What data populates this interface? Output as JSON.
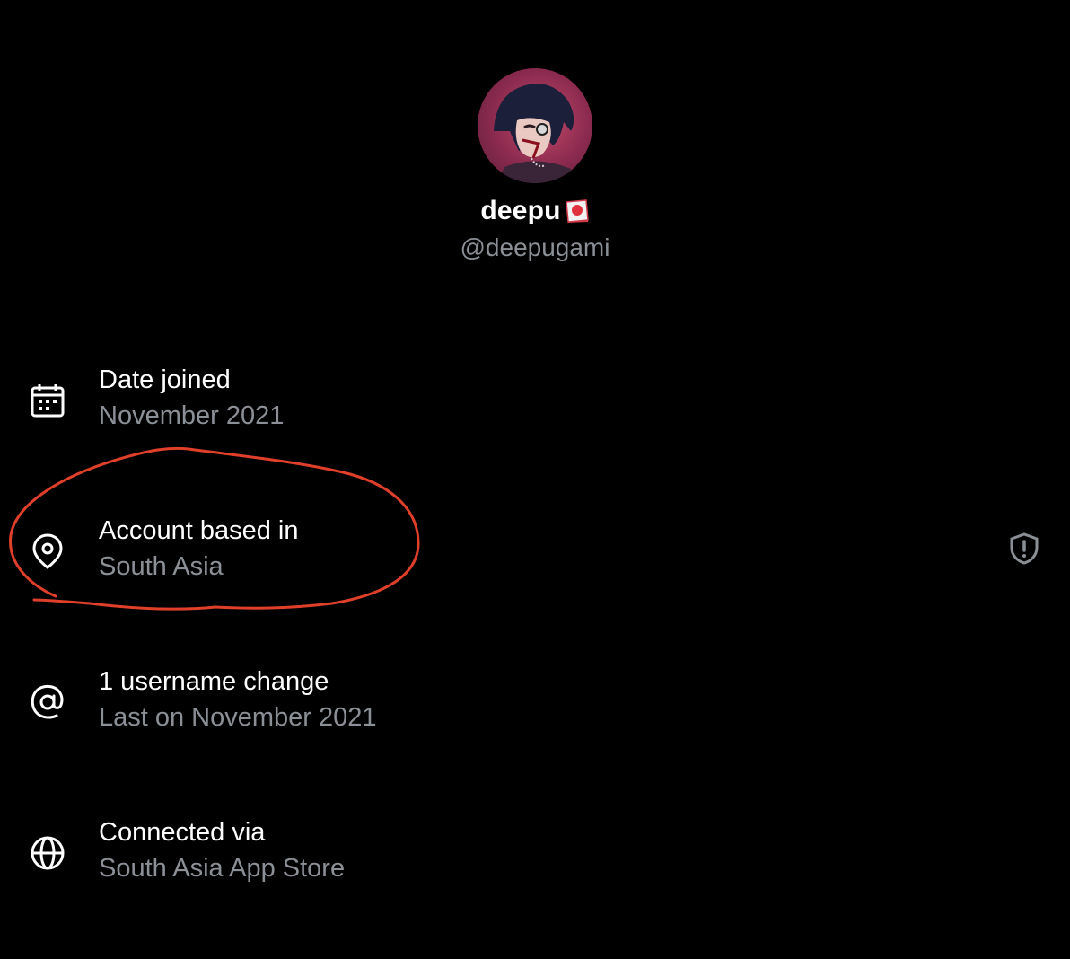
{
  "profile": {
    "display_name": "deepu",
    "handle": "@deepugami",
    "avatar": "profile-avatar-anime",
    "flag_icon": "red-circle-flag-icon"
  },
  "details": [
    {
      "icon": "calendar-icon",
      "label": "Date joined",
      "value": "November 2021"
    },
    {
      "icon": "location-pin-icon",
      "label": "Account based in",
      "value": "South Asia",
      "action_icon": "shield-alert-icon"
    },
    {
      "icon": "at-sign-icon",
      "label": "1 username change",
      "value": "Last on November 2021"
    },
    {
      "icon": "globe-icon",
      "label": "Connected via",
      "value": "South Asia App Store"
    }
  ],
  "colors": {
    "background": "#000000",
    "primary_text": "#ffffff",
    "secondary_text": "#8b9096",
    "annotation": "#e0402a"
  }
}
